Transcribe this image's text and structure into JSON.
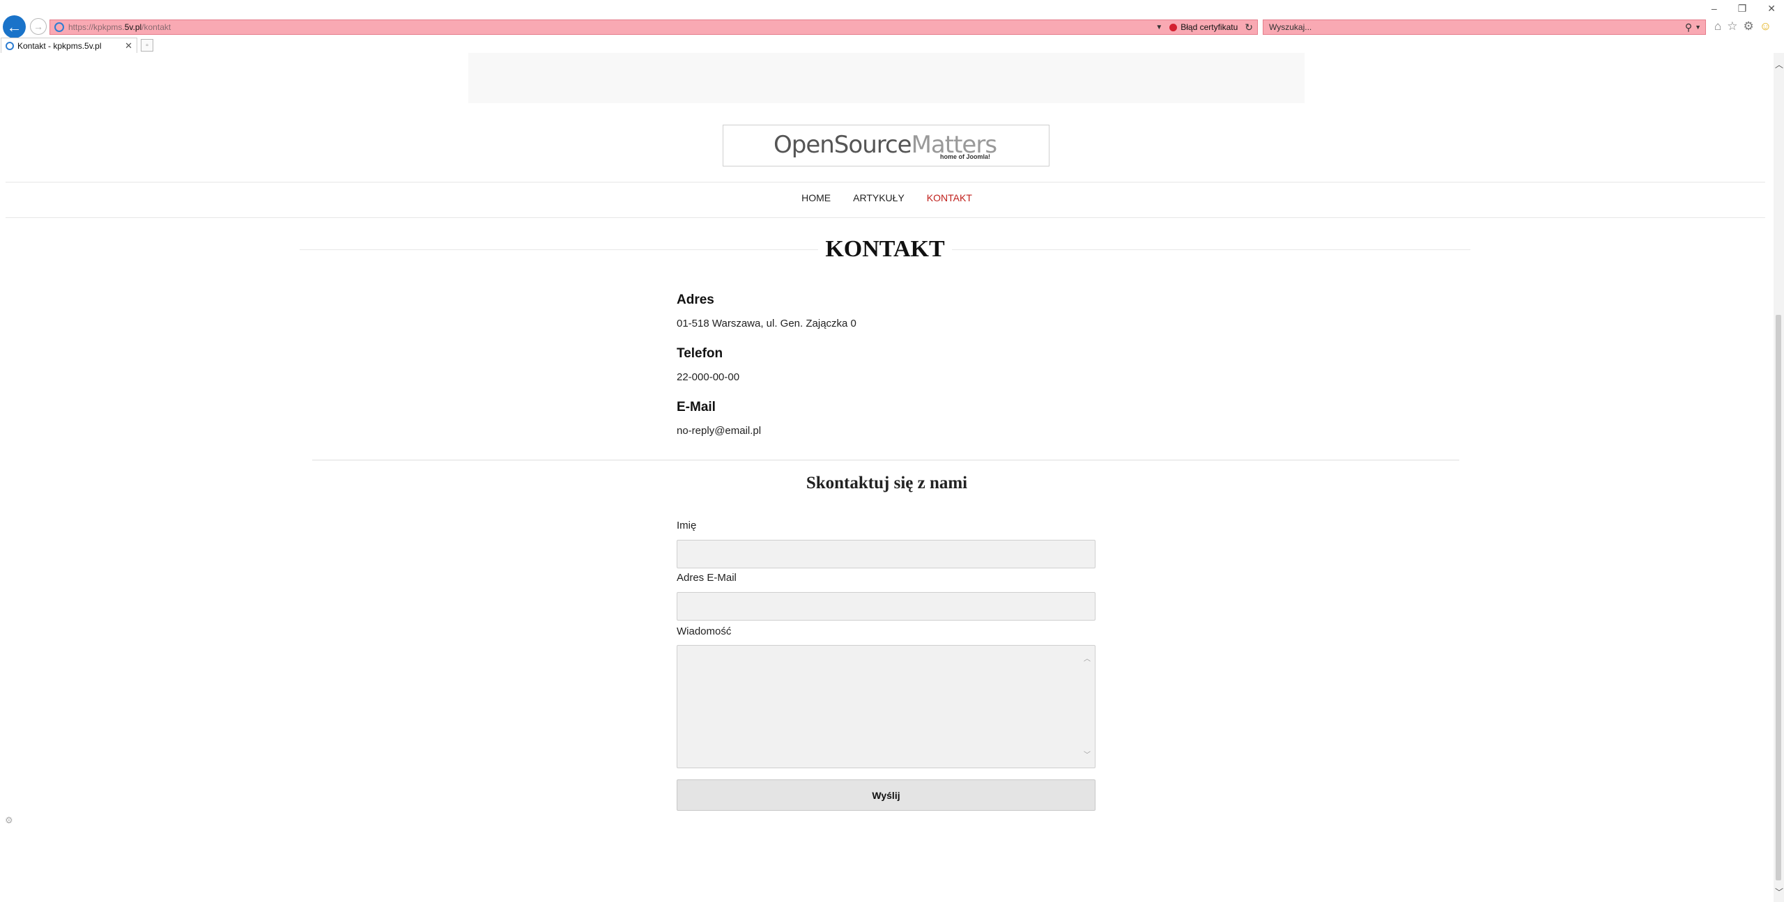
{
  "browser": {
    "url_prefix": "https://kpkpms.",
    "url_domain": "5v.pl",
    "url_path": "/kontakt",
    "cert_error": "Błąd certyfikatu",
    "search_placeholder": "Wyszukaj...",
    "tab_title": "Kontakt - kpkpms.5v.pl"
  },
  "logo": {
    "main_dark": "OpenSource",
    "main_light": "Matters",
    "subtitle": "home of Joomla!"
  },
  "menu": {
    "items": [
      {
        "label": "HOME",
        "active": false
      },
      {
        "label": "ARTYKUŁY",
        "active": false
      },
      {
        "label": "KONTAKT",
        "active": true
      }
    ]
  },
  "page": {
    "title": "KONTAKT"
  },
  "contact": {
    "address_label": "Adres",
    "address_value": "01-518 Warszawa, ul. Gen. Zajączka 0",
    "phone_label": "Telefon",
    "phone_value": "22-000-00-00",
    "email_label": "E-Mail",
    "email_value": "no-reply@email.pl"
  },
  "form": {
    "title": "Skontaktuj się z nami",
    "name_label": "Imię",
    "name_value": "",
    "email_label": "Adres E-Mail",
    "email_value": "",
    "message_label": "Wiadomość",
    "message_value": "",
    "submit_label": "Wyślij"
  },
  "colors": {
    "accent_active": "#c0201c",
    "address_bar_error": "#f9a9b3",
    "ie_blue": "#1a73c9"
  }
}
